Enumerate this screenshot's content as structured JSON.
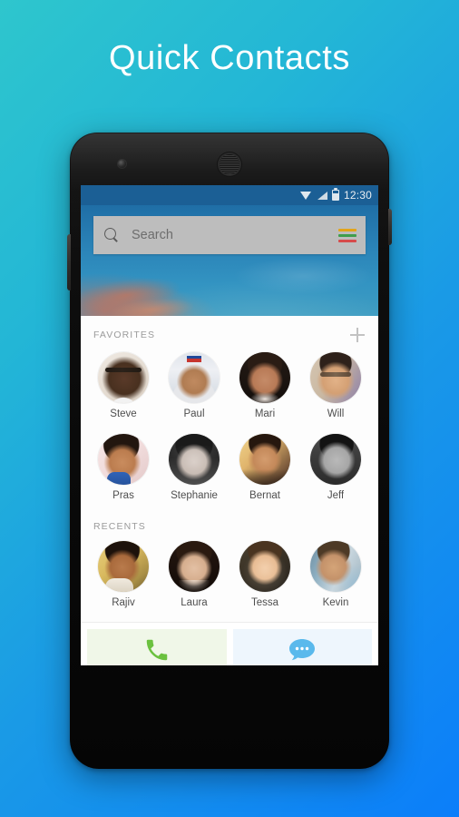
{
  "page": {
    "title": "Quick Contacts",
    "background_start": "#2ec6cd",
    "background_end": "#0b7efa"
  },
  "device": {
    "camera_icon": "camera-dot-icon",
    "earpiece_icon": "earpiece-speaker-icon",
    "volume_button": "volume-rocker-button",
    "power_button": "power-button"
  },
  "statusbar": {
    "time": "12:30",
    "wifi_icon": "wifi-icon",
    "signal_icon": "cellular-signal-icon",
    "battery_icon": "battery-icon",
    "background": "#1b5f95"
  },
  "search": {
    "value": "",
    "placeholder": "Search",
    "search_icon": "search-icon",
    "menu_icon": "hamburger-menu-icon",
    "menu_colors": [
      "#e3a419",
      "#3f9e4d",
      "#d64b4b"
    ],
    "background": "#bdbdbd"
  },
  "sections": [
    {
      "title": "FAVORITES",
      "has_add": true,
      "add_icon": "plus-icon",
      "contacts": [
        {
          "name": "Steve",
          "face": "f-steve"
        },
        {
          "name": "Paul",
          "face": "f-paul"
        },
        {
          "name": "Mari",
          "face": "f-mari"
        },
        {
          "name": "Will",
          "face": "f-will"
        },
        {
          "name": "Pras",
          "face": "f-pras"
        },
        {
          "name": "Stephanie",
          "face": "f-steph"
        },
        {
          "name": "Bernat",
          "face": "f-bernat"
        },
        {
          "name": "Jeff",
          "face": "f-jeff"
        }
      ]
    },
    {
      "title": "RECENTS",
      "has_add": false,
      "add_icon": "",
      "contacts": [
        {
          "name": "Rajiv",
          "face": "f-rajiv"
        },
        {
          "name": "Laura",
          "face": "f-laura"
        },
        {
          "name": "Tessa",
          "face": "f-tessa"
        },
        {
          "name": "Kevin",
          "face": "f-kevin"
        }
      ]
    }
  ],
  "actions": [
    {
      "name": "call",
      "icon": "phone-icon",
      "color": "#6bc13f",
      "background": "#f0f7e8"
    },
    {
      "name": "message",
      "icon": "message-bubble-icon",
      "color": "#5ab9ec",
      "background": "#eef6fd"
    }
  ]
}
